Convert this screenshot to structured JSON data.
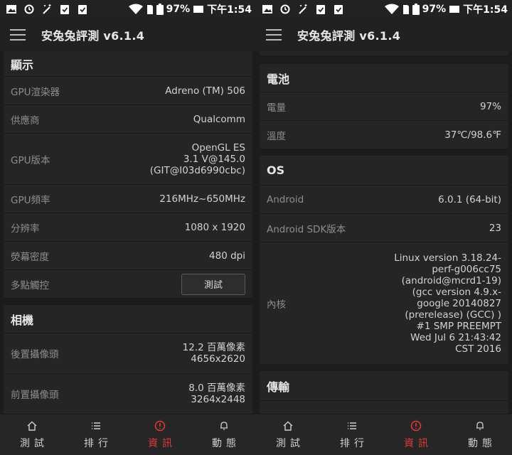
{
  "status": {
    "battery": "97%",
    "time": "下午1:54"
  },
  "app_title": "安兔兔評測 v6.1.4",
  "left": {
    "display": {
      "header": "顯示",
      "rows": [
        {
          "label": "GPU渲染器",
          "value": "Adreno (TM) 506"
        },
        {
          "label": "供應商",
          "value": "Qualcomm"
        },
        {
          "label": "GPU版本",
          "value": "OpenGL ES\n3.1 V@145.0\n(GIT@I03d6990cbc)"
        },
        {
          "label": "GPU頻率",
          "value": "216MHz~650MHz"
        },
        {
          "label": "分辨率",
          "value": "1080 x 1920"
        },
        {
          "label": "熒幕密度",
          "value": "480 dpi"
        },
        {
          "label": "多點觸控",
          "button": "測試"
        }
      ]
    },
    "camera": {
      "header": "相機",
      "rows": [
        {
          "label": "後置攝像頭",
          "value": "12.2 百萬像素\n4656x2620"
        },
        {
          "label": "前置攝像頭",
          "value": "8.0 百萬像素\n3264x2448"
        }
      ]
    }
  },
  "right": {
    "battery": {
      "header": "電池",
      "rows": [
        {
          "label": "電量",
          "value": "97%"
        },
        {
          "label": "溫度",
          "value": "37℃/98.6℉"
        }
      ]
    },
    "os": {
      "header": "OS",
      "rows": [
        {
          "label": "Android",
          "value": "6.0.1 (64-bit)"
        },
        {
          "label": "Android SDK版本",
          "value": "23"
        },
        {
          "label": "內核",
          "value": "Linux version 3.18.24-\nperf-g006cc75\n(android@mcrd1-19)\n(gcc version 4.9.x-\ngoogle 20140827\n(prerelease) (GCC) )\n#1 SMP PREEMPT\nWed Jul 6 21:43:42\nCST 2016"
        }
      ]
    },
    "transfer": {
      "header": "傳輸"
    }
  },
  "nav": [
    {
      "label": "測試",
      "icon": "home-icon"
    },
    {
      "label": "排行",
      "icon": "list-icon"
    },
    {
      "label": "資訊",
      "icon": "info-icon",
      "active": true
    },
    {
      "label": "動態",
      "icon": "bell-icon"
    }
  ],
  "colors": {
    "accent": "#e53935",
    "background": "#1c1c1c",
    "card": "#252525"
  }
}
